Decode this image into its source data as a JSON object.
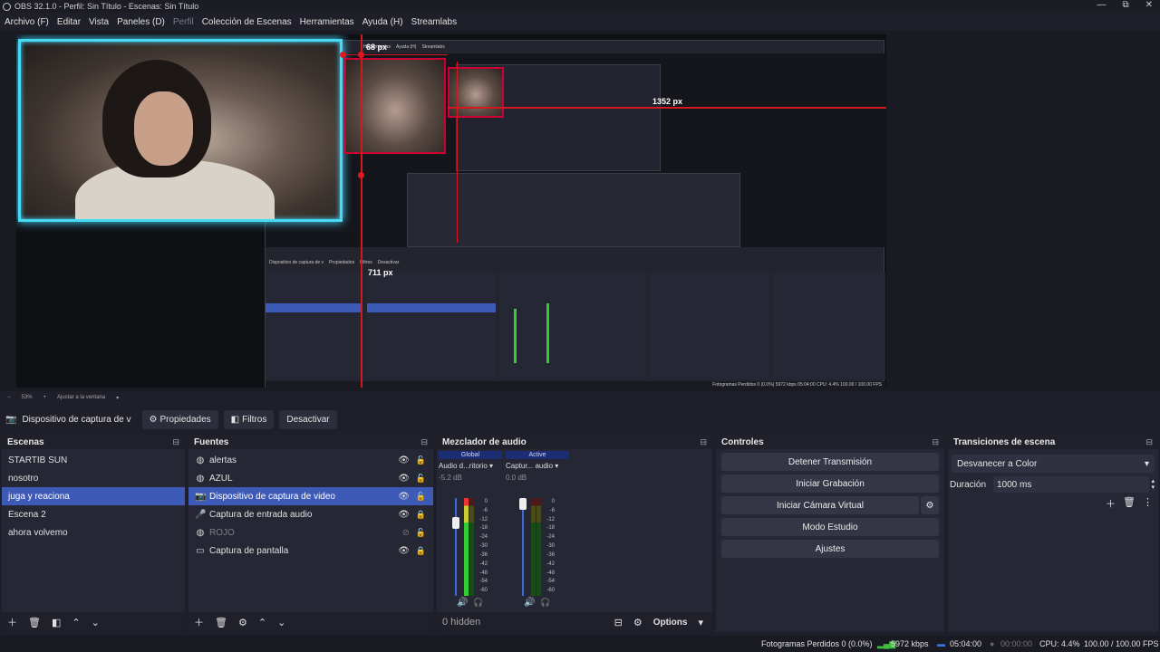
{
  "titlebar": {
    "title": "OBS 32.1.0 - Perfil: Sin Título - Escenas: Sin Título",
    "minimize": "—",
    "maximize": "⧉",
    "close": "✕"
  },
  "menu": [
    "Archivo (F)",
    "Editar",
    "Vista",
    "Paneles (D)",
    "Perfil",
    "Colección de Escenas",
    "Herramientas",
    "Ayuda (H)",
    "Streamlabs"
  ],
  "preview": {
    "label_68": "68 px",
    "label_1352": "1352 px",
    "label_711": "711 px",
    "nested_menu": [
      "Archivo (F)",
      "Editar",
      "Vista",
      "Paneles (D)",
      "Perfil",
      "Colección de Escenas",
      "Herramientas",
      "Ayuda (H)",
      "Streamlabs"
    ],
    "nested_source_bar": {
      "source": "Dispositivo de captura de v",
      "properties": "Propiedades",
      "filters": "Filtros",
      "deactivate": "Desactivar"
    },
    "nested_zoom": "53%",
    "nested_fit": "Ajustar a la ventana",
    "nested_status": "Fotogramas Perdidos 0 (0.0%)   5972 kbps   05:04:00   CPU: 4.4%   100.00 / 100.00 FPS"
  },
  "zoom": {
    "level": "53%",
    "fit": "Ajustar a la ventana"
  },
  "source_bar": {
    "name": "Dispositivo de captura de v",
    "properties": "Propiedades",
    "filters": "Filtros",
    "deactivate": "Desactivar"
  },
  "scenes": {
    "title": "Escenas",
    "items": [
      "STARTIB SUN",
      "nosotro",
      "juga y reaciona",
      "Escena 2",
      "ahora volvemo"
    ]
  },
  "sources": {
    "title": "Fuentes",
    "items": [
      "alertas",
      "AZUL",
      "Dispositivo de captura de video",
      "Captura de entrada audio",
      "ROJO",
      "Captura de pantalla"
    ]
  },
  "mixer": {
    "title": "Mezclador de audio",
    "channels": [
      {
        "header": "Global",
        "name": "Audio d...ritorio",
        "db": "-5.2 dB",
        "level": 0.78
      },
      {
        "header": "Active",
        "name": "Captur... audio",
        "db": "0.0 dB",
        "level": 1.0
      }
    ],
    "ticks": [
      "0",
      "-6",
      "-12",
      "-18",
      "-24",
      "-30",
      "-36",
      "-42",
      "-48",
      "-54",
      "-60"
    ],
    "hidden": "0 hidden",
    "options": "Options"
  },
  "controls": {
    "title": "Controles",
    "buttons": [
      "Detener Transmisión",
      "Iniciar Grabación",
      "Iniciar Cámara Virtual",
      "Modo Estudio",
      "Ajustes"
    ]
  },
  "transitions": {
    "title": "Transiciones de escena",
    "selected": "Desvanecer a Color",
    "duration_label": "Duración",
    "duration": "1000 ms"
  },
  "status": {
    "dropped": "Fotogramas Perdidos 0 (0.0%)",
    "kbps": "5972 kbps",
    "stream_time": "05:04:00",
    "rec_time": "00:00:00",
    "cpu": "CPU: 4.4%",
    "fps": "100.00 / 100.00 FPS"
  }
}
